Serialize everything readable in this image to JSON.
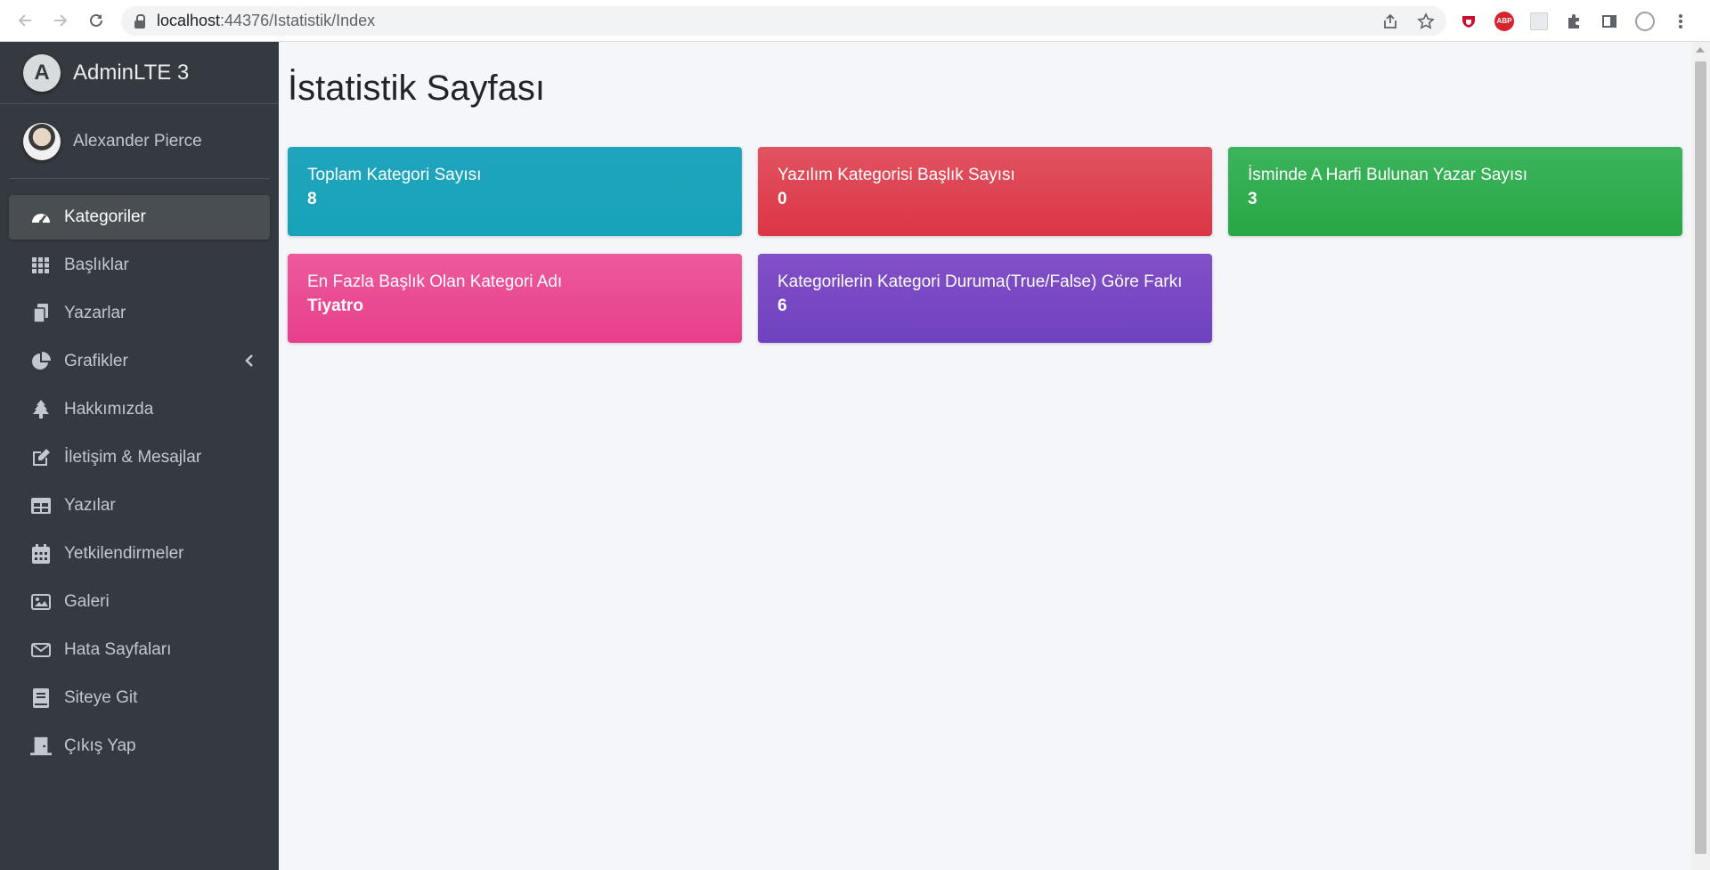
{
  "browser": {
    "url_host": "localhost",
    "url_rest": ":44376/Istatistik/Index",
    "icons": [
      "back-icon",
      "forward-icon",
      "reload-icon",
      "lock-icon",
      "share-icon",
      "star-icon",
      "extension-shield-icon",
      "adblock-icon",
      "extension-icon",
      "puzzle-icon",
      "side-panel-icon",
      "profile-icon",
      "menu-icon"
    ],
    "adblock_label": "ABP"
  },
  "sidebar": {
    "brand": "AdminLTE 3",
    "user_name": "Alexander Pierce",
    "items": [
      {
        "label": "Kategoriler",
        "icon": "tachometer-icon",
        "active": true
      },
      {
        "label": "Başlıklar",
        "icon": "grid-icon"
      },
      {
        "label": "Yazarlar",
        "icon": "copy-icon"
      },
      {
        "label": "Grafikler",
        "icon": "pie-chart-icon",
        "has_chevron": true
      },
      {
        "label": "Hakkımızda",
        "icon": "tree-icon"
      },
      {
        "label": "İletişim & Mesajlar",
        "icon": "edit-icon"
      },
      {
        "label": "Yazılar",
        "icon": "table-icon"
      },
      {
        "label": "Yetkilendirmeler",
        "icon": "calendar-icon"
      },
      {
        "label": "Galeri",
        "icon": "image-icon"
      },
      {
        "label": "Hata Sayfaları",
        "icon": "envelope-icon"
      },
      {
        "label": "Siteye Git",
        "icon": "book-icon"
      },
      {
        "label": "Çıkış Yap",
        "icon": "door-icon"
      }
    ]
  },
  "main": {
    "title": "İstatistik Sayfası",
    "boxes": [
      {
        "title": "Toplam Kategori Sayısı",
        "value": "8",
        "color": "#17a2b8"
      },
      {
        "title": "Yazılım Kategorisi Başlık Sayısı",
        "value": "0",
        "color": "#dc3545"
      },
      {
        "title": "İsminde A Harfi Bulunan Yazar Sayısı",
        "value": "3",
        "color": "#28a745"
      },
      {
        "title": "En Fazla Başlık Olan Kategori Adı",
        "value": "Tiyatro",
        "color": "#e83e8c"
      },
      {
        "title": "Kategorilerin Kategori Duruma(True/False) Göre Farkı",
        "value": "6",
        "color": "#6f42c1"
      }
    ]
  }
}
